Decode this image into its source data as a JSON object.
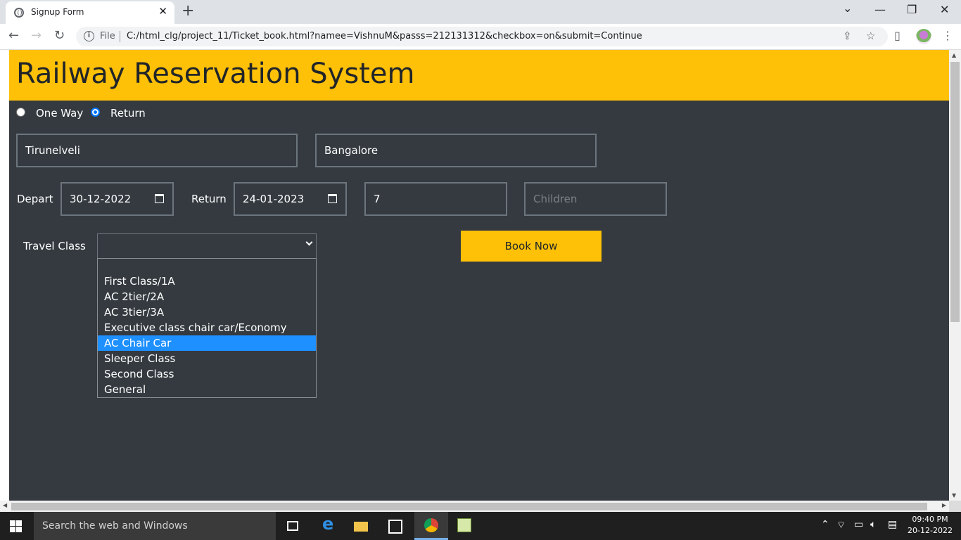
{
  "browser": {
    "tab_title": "Signup Form",
    "tab_close": "✕",
    "new_tab": "+",
    "url_scheme_label": "File",
    "url": "C:/html_clg/project_11/Ticket_book.html?namee=VishnuM&passs=212131312&checkbox=on&submit=Continue",
    "window_controls": [
      "⌄",
      "—",
      "❐",
      "✕"
    ]
  },
  "page": {
    "title": "Railway Reservation System",
    "trip": {
      "one_way_label": "One Way",
      "return_label": "Return",
      "selected": "Return"
    },
    "from": {
      "value": "Tirunelveli"
    },
    "to": {
      "value": "Bangalore"
    },
    "depart": {
      "label": "Depart",
      "value": "30-12-2022"
    },
    "return": {
      "label": "Return",
      "value": "24-01-2023"
    },
    "adults": {
      "value": "7"
    },
    "children": {
      "placeholder": "Children"
    },
    "travel_class": {
      "label": "Travel Class",
      "selected_value": "",
      "options": [
        "",
        "First Class/1A",
        "AC 2tier/2A",
        "AC 3tier/3A",
        "Executive class chair car/Economy Class",
        "AC Chair Car",
        "Sleeper Class",
        "Second Class",
        "General"
      ],
      "highlighted": "AC Chair Car"
    },
    "book_button": "Book Now"
  },
  "taskbar": {
    "search_placeholder": "Search the web and Windows",
    "time": "09:40 PM",
    "date": "20-12-2022"
  },
  "colors": {
    "header": "#ffc107",
    "background": "#343a40",
    "highlight": "#1e90ff"
  }
}
